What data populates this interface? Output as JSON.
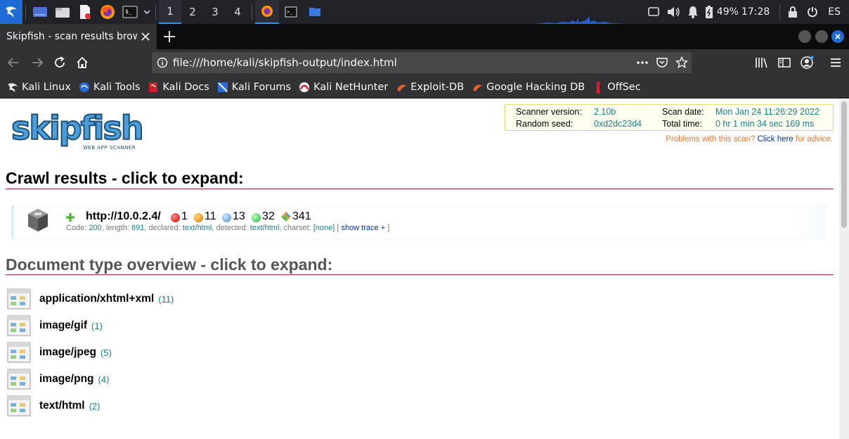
{
  "desktop": {
    "workspaces": [
      "1",
      "2",
      "3",
      "4"
    ],
    "active_workspace": "1",
    "battery": "49%",
    "clock": "17:28",
    "keyboard_layout": "ES"
  },
  "browser": {
    "tab_title": "Skipfish - scan results browser",
    "url": "file:///home/kali/skipfish-output/index.html",
    "bookmarks": [
      {
        "label": "Kali Linux",
        "icon": "kali-dragon-icon"
      },
      {
        "label": "Kali Tools",
        "icon": "kali-tools-icon"
      },
      {
        "label": "Kali Docs",
        "icon": "kali-docs-icon"
      },
      {
        "label": "Kali Forums",
        "icon": "kali-forums-icon"
      },
      {
        "label": "Kali NetHunter",
        "icon": "nethunter-icon"
      },
      {
        "label": "Exploit-DB",
        "icon": "exploit-db-icon"
      },
      {
        "label": "Google Hacking DB",
        "icon": "ghdb-icon"
      },
      {
        "label": "OffSec",
        "icon": "offsec-icon"
      }
    ]
  },
  "page": {
    "logo_text": "skipfish",
    "logo_subtitle": "WEB APP SCANNER",
    "summary": {
      "scanner_version_label": "Scanner version:",
      "scanner_version": "2.10b",
      "random_seed_label": "Random seed:",
      "random_seed": "0xd2dc23d4",
      "scan_date_label": "Scan date:",
      "scan_date": "Mon Jan 24 11:26:29 2022",
      "total_time_label": "Total time:",
      "total_time": "0 hr 1 min 34 sec 169 ms"
    },
    "problems_text": "Problems with this scan?",
    "problems_link": "Click here",
    "problems_suffix": "for advice.",
    "crawl_heading": "Crawl results - click to expand:",
    "crawl": {
      "url": "http://10.0.2.4/",
      "counts": {
        "high": "1",
        "medium": "11",
        "low": "13",
        "warning": "32",
        "info": "341"
      },
      "code_label": "Code:",
      "code": "200",
      "length_label": ", length:",
      "length": "891",
      "declared_label": ", declared:",
      "declared": "text/html",
      "detected_label": ", detected:",
      "detected": "text/html",
      "charset_label": ", charset:",
      "charset": "[none]",
      "trace_open": "[",
      "trace_link": "show trace +",
      "trace_close": "]"
    },
    "doctype_heading": "Document type overview - click to expand:",
    "doc_types": [
      {
        "type": "application/xhtml+xml",
        "count": "(11)"
      },
      {
        "type": "image/gif",
        "count": "(1)"
      },
      {
        "type": "image/jpeg",
        "count": "(5)"
      },
      {
        "type": "image/png",
        "count": "(4)"
      },
      {
        "type": "text/html",
        "count": "(2)"
      }
    ]
  }
}
